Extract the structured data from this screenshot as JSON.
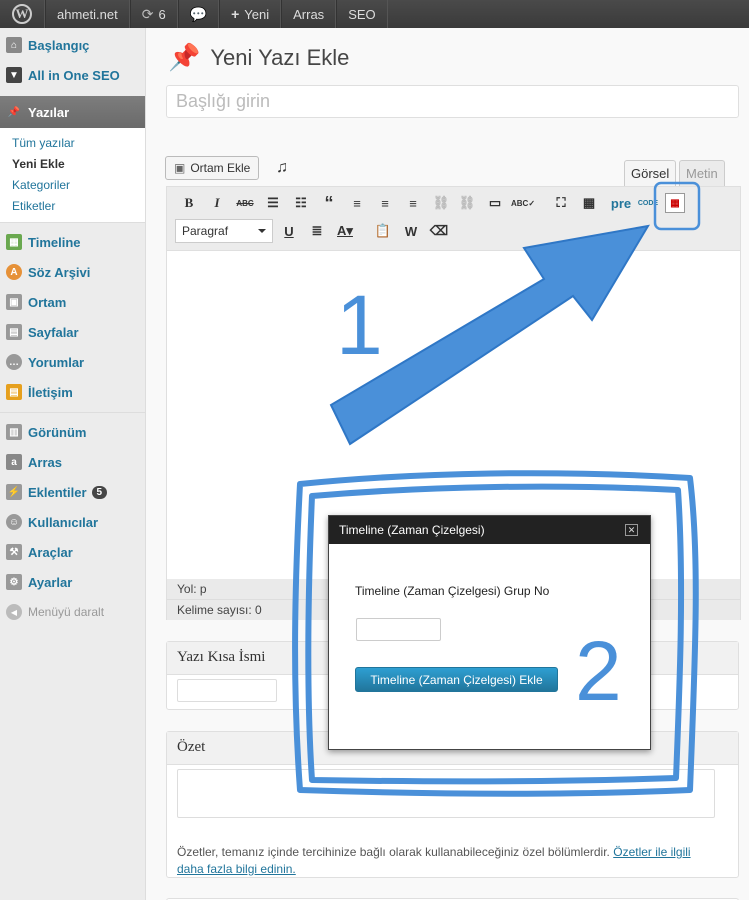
{
  "admin_bar": {
    "site": "ahmeti.net",
    "updates": "6",
    "new_label": "Yeni",
    "menu1": "Arras",
    "menu2": "SEO"
  },
  "sidebar": {
    "items_top": [
      {
        "label": "Başlangıç",
        "icon": "home-icon"
      },
      {
        "label": "All in One SEO",
        "icon": "shield-icon"
      }
    ],
    "active": {
      "label": "Yazılar",
      "icon": "pin-icon"
    },
    "submenu": [
      "Tüm yazılar",
      "Yeni Ekle",
      "Kategoriler",
      "Etiketler"
    ],
    "items_mid": [
      {
        "label": "Timeline",
        "icon": "timeline-icon",
        "color": "#6aa84f"
      },
      {
        "label": "Söz Arşivi",
        "icon": "quote-icon",
        "color": "#e69138"
      },
      {
        "label": "Ortam",
        "icon": "media-icon",
        "color": "#888888"
      },
      {
        "label": "Sayfalar",
        "icon": "pages-icon",
        "color": "#888888"
      },
      {
        "label": "Yorumlar",
        "icon": "comments-icon",
        "color": "#888888"
      },
      {
        "label": "İletişim",
        "icon": "contact-icon",
        "color": "#e6a01e"
      }
    ],
    "items_bottom": [
      {
        "label": "Görünüm",
        "icon": "appearance-icon",
        "color": "#888888"
      },
      {
        "label": "Arras",
        "icon": "arras-icon",
        "color": "#888888"
      },
      {
        "label": "Eklentiler",
        "icon": "plugins-icon",
        "color": "#888888",
        "badge": "5"
      },
      {
        "label": "Kullanıcılar",
        "icon": "users-icon",
        "color": "#888888"
      },
      {
        "label": "Araçlar",
        "icon": "tools-icon",
        "color": "#888888"
      },
      {
        "label": "Ayarlar",
        "icon": "settings-icon",
        "color": "#888888"
      }
    ],
    "collapse": "Menüyü daralt"
  },
  "main": {
    "title": "Yeni Yazı Ekle",
    "title_placeholder": "Başlığı girin",
    "media_button": "Ortam Ekle",
    "tab_visual": "Görsel",
    "tab_text": "Metin",
    "format_select": "Paragraf",
    "toolbar_pre": "pre",
    "toolbar_code": "CODE",
    "path": "Yol: p",
    "word_count": "Kelime sayısı: 0"
  },
  "slug_box": {
    "title": "Yazı Kısa İsmi"
  },
  "excerpt_box": {
    "title": "Özet",
    "help": "Özetler, temanız içinde tercihinize bağlı olarak kullanabileceğiniz özel bölümlerdir.",
    "help_link": "Özetler ile ilgili daha fazla bilgi edinin."
  },
  "dialog": {
    "title": "Timeline (Zaman Çizelgesi)",
    "label": "Timeline (Zaman Çizelgesi) Grup No",
    "button": "Timeline (Zaman Çizelgesi) Ekle"
  },
  "annotations": {
    "one": "1",
    "two": "2",
    "color": "#4a90d9"
  }
}
